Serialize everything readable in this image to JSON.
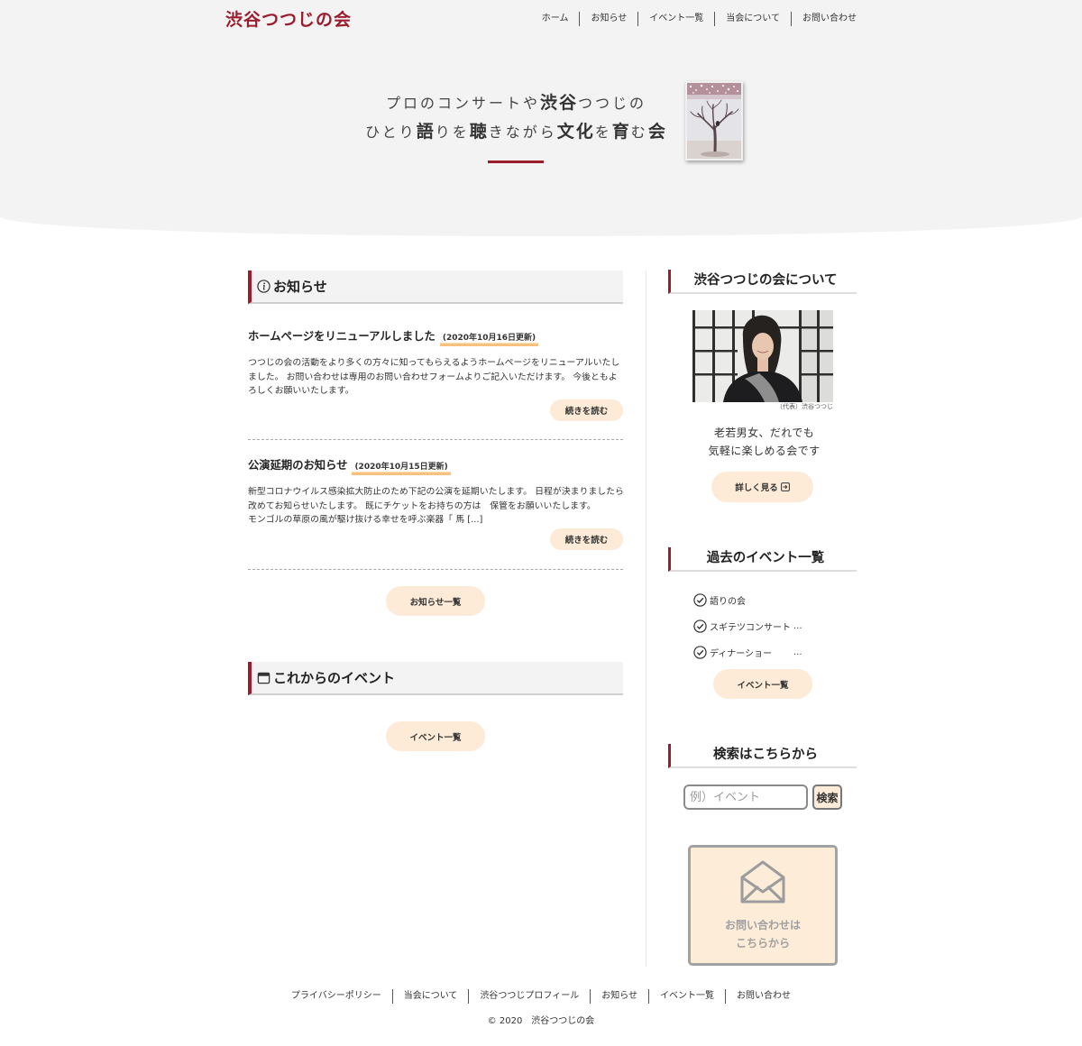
{
  "site": {
    "logo": "渋谷つつじの会"
  },
  "nav": [
    {
      "label": "ホーム"
    },
    {
      "label": "お知らせ"
    },
    {
      "label": "イベント一覧"
    },
    {
      "label": "当会について"
    },
    {
      "label": "お問い合わせ"
    }
  ],
  "hero": {
    "line1": [
      "プロのコンサートや",
      "渋谷",
      "つつじの"
    ],
    "line2": [
      "ひとり",
      "語",
      "りを",
      "聴",
      "きながら",
      "文化",
      "を",
      "育",
      "む",
      "会"
    ]
  },
  "news": {
    "heading": "お知らせ",
    "heading_icon": "info-icon",
    "posts": [
      {
        "title": "ホームページをリニューアルしました",
        "date": "(2020年10月16日更新)",
        "excerpt": [
          "つつじの会の活動をより多くの方々に知ってもらえるようホームページをリニューアルいたしました。 お問い合わせは専用のお問い合わせフォームよりご記入いただけます。 今後ともよろしくお願いいたします。"
        ],
        "more_label": "続きを読む"
      },
      {
        "title": "公演延期のお知らせ",
        "date": "(2020年10月15日更新)",
        "excerpt": [
          "新型コロナウイルス感染拡大防止のため下記の公演を延期いたします。 日程が決まりましたら改めてお知らせいたします。 既にチケットをお持ちの方は　保管をお願いいたします。",
          "モンゴルの草原の風が駆け抜ける幸せを呼ぶ楽器「 馬 [...]"
        ],
        "more_label": "続きを読む"
      }
    ],
    "all_label": "お知らせ一覧"
  },
  "upcoming_events": {
    "heading": "これからのイベント",
    "heading_icon": "calendar-icon",
    "all_label": "イベント一覧"
  },
  "sidebar": {
    "about": {
      "heading": "渋谷つつじの会について",
      "photo_caption": "（代表）渋谷つつじ",
      "tagline": [
        "老若男女、だれでも",
        "気軽に楽しめる会です"
      ],
      "more_label": "詳しく見る",
      "more_icon": "arrow-box-icon"
    },
    "past_events": {
      "heading": "過去のイベント一覧",
      "item_icon": "check-circle-icon",
      "items": [
        {
          "name": "語りの会"
        },
        {
          "name": "スギテツコンサート",
          "ellipsis": "..."
        },
        {
          "name": "ディナーショー",
          "ellipsis": "..."
        }
      ],
      "all_label": "イベント一覧"
    },
    "search": {
      "heading": "検索はこちらから",
      "placeholder": "例）イベント",
      "button_label": "検索"
    },
    "contact": {
      "icon": "mail-icon",
      "lines": [
        "お問い合わせは",
        "こちらから"
      ]
    }
  },
  "footer": {
    "links": [
      {
        "label": "プライバシーポリシー"
      },
      {
        "label": "当会について"
      },
      {
        "label": "渋谷つつじプロフィール"
      },
      {
        "label": "お知らせ"
      },
      {
        "label": "イベント一覧"
      },
      {
        "label": "お問い合わせ"
      }
    ],
    "copyright": "© 2020　渋谷つつじの会"
  },
  "colors": {
    "accent": "#9b1c2c",
    "button_bg": "#fdebd7",
    "date_highlight": "#f8c27e",
    "hero_bg": "#f3f3f3",
    "text": "#333333"
  }
}
